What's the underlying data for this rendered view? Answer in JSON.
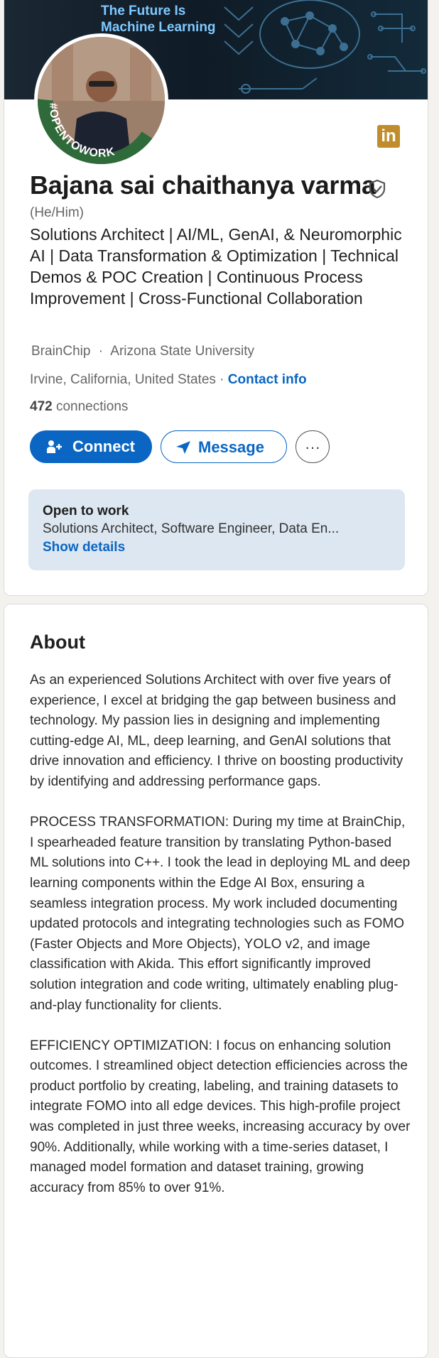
{
  "banner": {
    "line1": "The Future Is",
    "line2": "Machine Learning"
  },
  "avatar": {
    "badge_text": "#OPENTOWORK"
  },
  "linkedin_icon": "in",
  "profile": {
    "name": "Bajana sai chaithanya varma",
    "pronouns": "(He/Him)",
    "headline": "Solutions Architect | AI/ML, GenAI, & Neuromorphic AI | Data Transformation & Optimization | Technical Demos & POC Creation | Continuous Process Improvement | Cross-Functional Collaboration",
    "company": "BrainChip",
    "separator": "·",
    "school": "Arizona State University",
    "location": "Irvine, California, United States ·",
    "contact_info": "Contact info",
    "connections_count": "472",
    "connections_label": "connections"
  },
  "actions": {
    "connect": "Connect",
    "message": "Message",
    "more": "···"
  },
  "open_to_work": {
    "title": "Open to work",
    "roles": "Solutions Architect, Software Engineer, Data En...",
    "show_details": "Show details"
  },
  "about": {
    "title": "About",
    "paragraphs": [
      "As an experienced Solutions Architect with over five years of experience, I excel at bridging the gap between business and technology. My passion lies in designing and implementing cutting-edge AI, ML, deep learning, and GenAI solutions that drive innovation and efficiency. I thrive on boosting productivity by identifying and addressing performance gaps.",
      "PROCESS TRANSFORMATION: During my time at BrainChip, I spearheaded feature transition by translating Python-based ML solutions into C++. I took the lead in deploying ML and deep learning components within the Edge AI Box, ensuring a seamless integration process. My work included documenting updated protocols and integrating technologies such as FOMO (Faster Objects and More Objects), YOLO v2, and image classification with Akida. This effort significantly improved solution integration and code writing, ultimately enabling plug-and-play functionality for clients.",
      "EFFICIENCY OPTIMIZATION: I focus on enhancing solution outcomes. I streamlined object detection efficiencies across the product portfolio by creating, labeling, and training datasets to integrate FOMO into all edge devices. This high-profile project was completed in just three weeks, increasing accuracy by over 90%. Additionally, while working with a time-series dataset, I managed model formation and dataset training, growing accuracy from 85% to over 91%."
    ]
  },
  "colors": {
    "accent": "#0a66c2",
    "open_to_work_bg": "#dde7f1",
    "otw_green": "#2f6b3a",
    "linkedin_gold": "#c08c2c"
  }
}
